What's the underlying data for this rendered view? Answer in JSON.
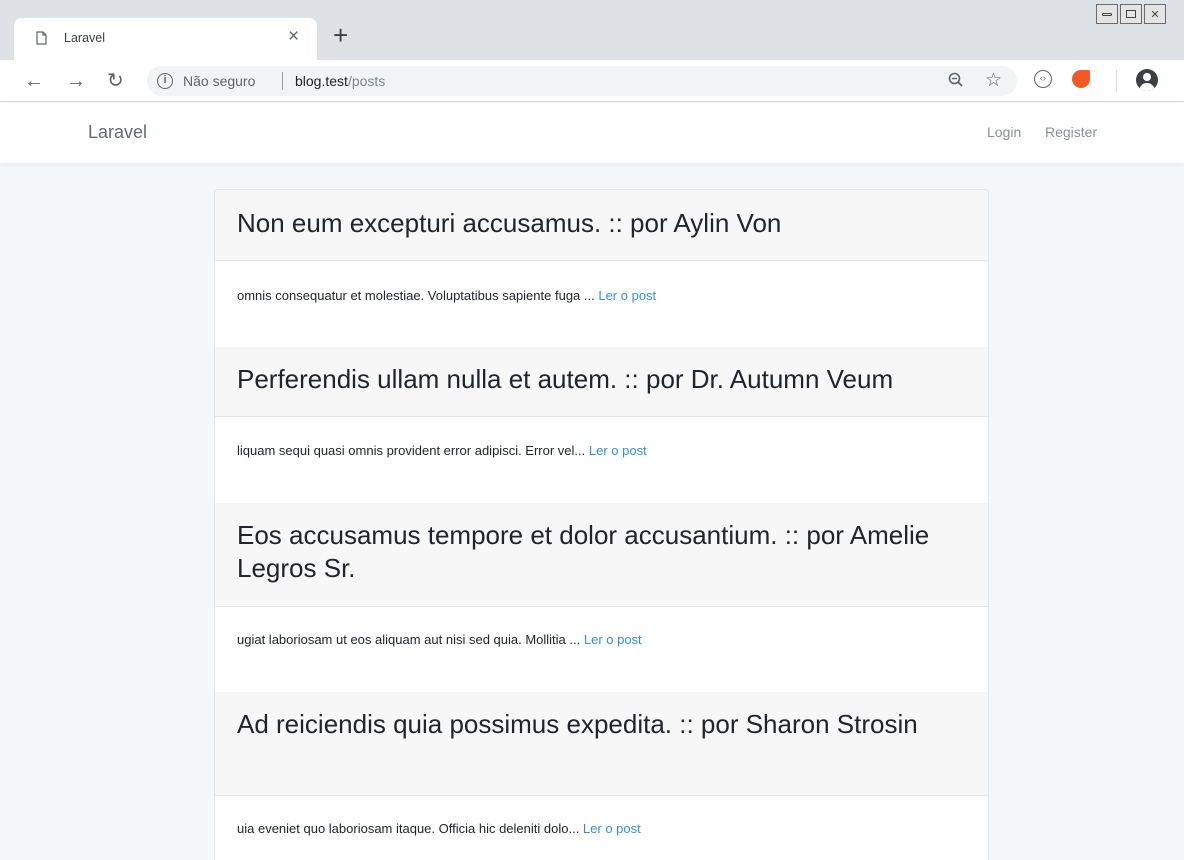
{
  "browser": {
    "tab_title": "Laravel",
    "tab_close": "×",
    "new_tab": "+",
    "security_label": "Não seguro",
    "url_host": "blog.test",
    "url_path": "/posts"
  },
  "navbar": {
    "brand": "Laravel",
    "login": "Login",
    "register": "Register"
  },
  "posts": [
    {
      "title": "Non eum excepturi accusamus. :: por Aylin Von",
      "excerpt": "omnis consequatur et molestiae. Voluptatibus sapiente fuga ... ",
      "link": "Ler o post"
    },
    {
      "title": "Perferendis ullam nulla et autem. :: por Dr. Autumn Veum",
      "excerpt": "liquam sequi quasi omnis provident error adipisci. Error vel... ",
      "link": "Ler o post"
    },
    {
      "title": "Eos accusamus tempore et dolor accusantium. :: por Amelie Legros Sr.",
      "excerpt": "ugiat laboriosam ut eos aliquam aut nisi sed quia. Mollitia ... ",
      "link": "Ler o post"
    },
    {
      "title": "Ad reiciendis quia possimus expedita. :: por Sharon Strosin",
      "excerpt": "uia eveniet quo laboriosam itaque. Officia hic deleniti dolo... ",
      "link": "Ler o post"
    }
  ]
}
